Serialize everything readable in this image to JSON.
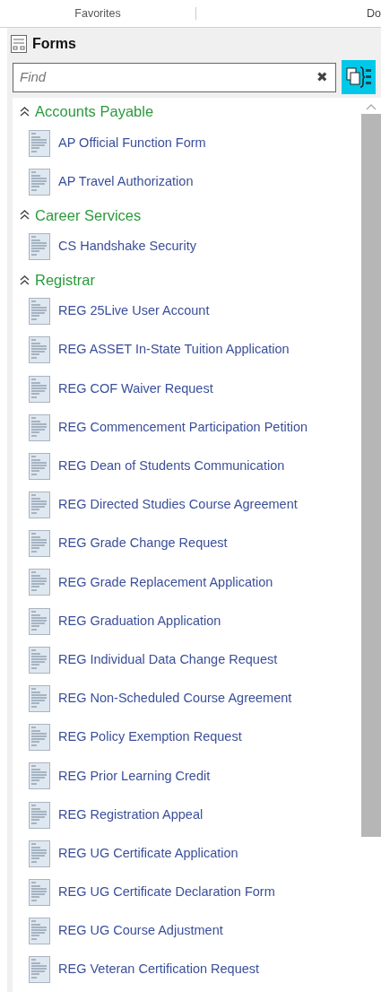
{
  "tabs": [
    {
      "label": "Favorites"
    },
    {
      "label": "Do"
    }
  ],
  "panel": {
    "title": "Forms"
  },
  "search": {
    "placeholder": "Find",
    "clear": "✖"
  },
  "groups": [
    {
      "name": "Accounts Payable",
      "expanded": true,
      "items": [
        "AP Official Function Form",
        "AP Travel Authorization"
      ]
    },
    {
      "name": "Career Services",
      "expanded": true,
      "items": [
        "CS Handshake Security"
      ]
    },
    {
      "name": "Registrar",
      "expanded": true,
      "items": [
        "REG 25Live User Account",
        "REG ASSET In-State Tuition Application",
        "REG COF Waiver Request",
        "REG Commencement Participation Petition",
        "REG Dean of Students Communication",
        "REG Directed Studies Course Agreement",
        "REG Grade Change Request",
        "REG Grade Replacement Application",
        "REG Graduation Application",
        "REG Individual Data Change Request",
        "REG Non-Scheduled Course Agreement",
        "REG Policy Exemption Request",
        "REG Prior Learning Credit",
        "REG Registration Appeal",
        "REG UG Certificate Application",
        "REG UG Certificate Declaration Form",
        "REG UG Course Adjustment",
        "REG Veteran Certification Request"
      ]
    }
  ]
}
